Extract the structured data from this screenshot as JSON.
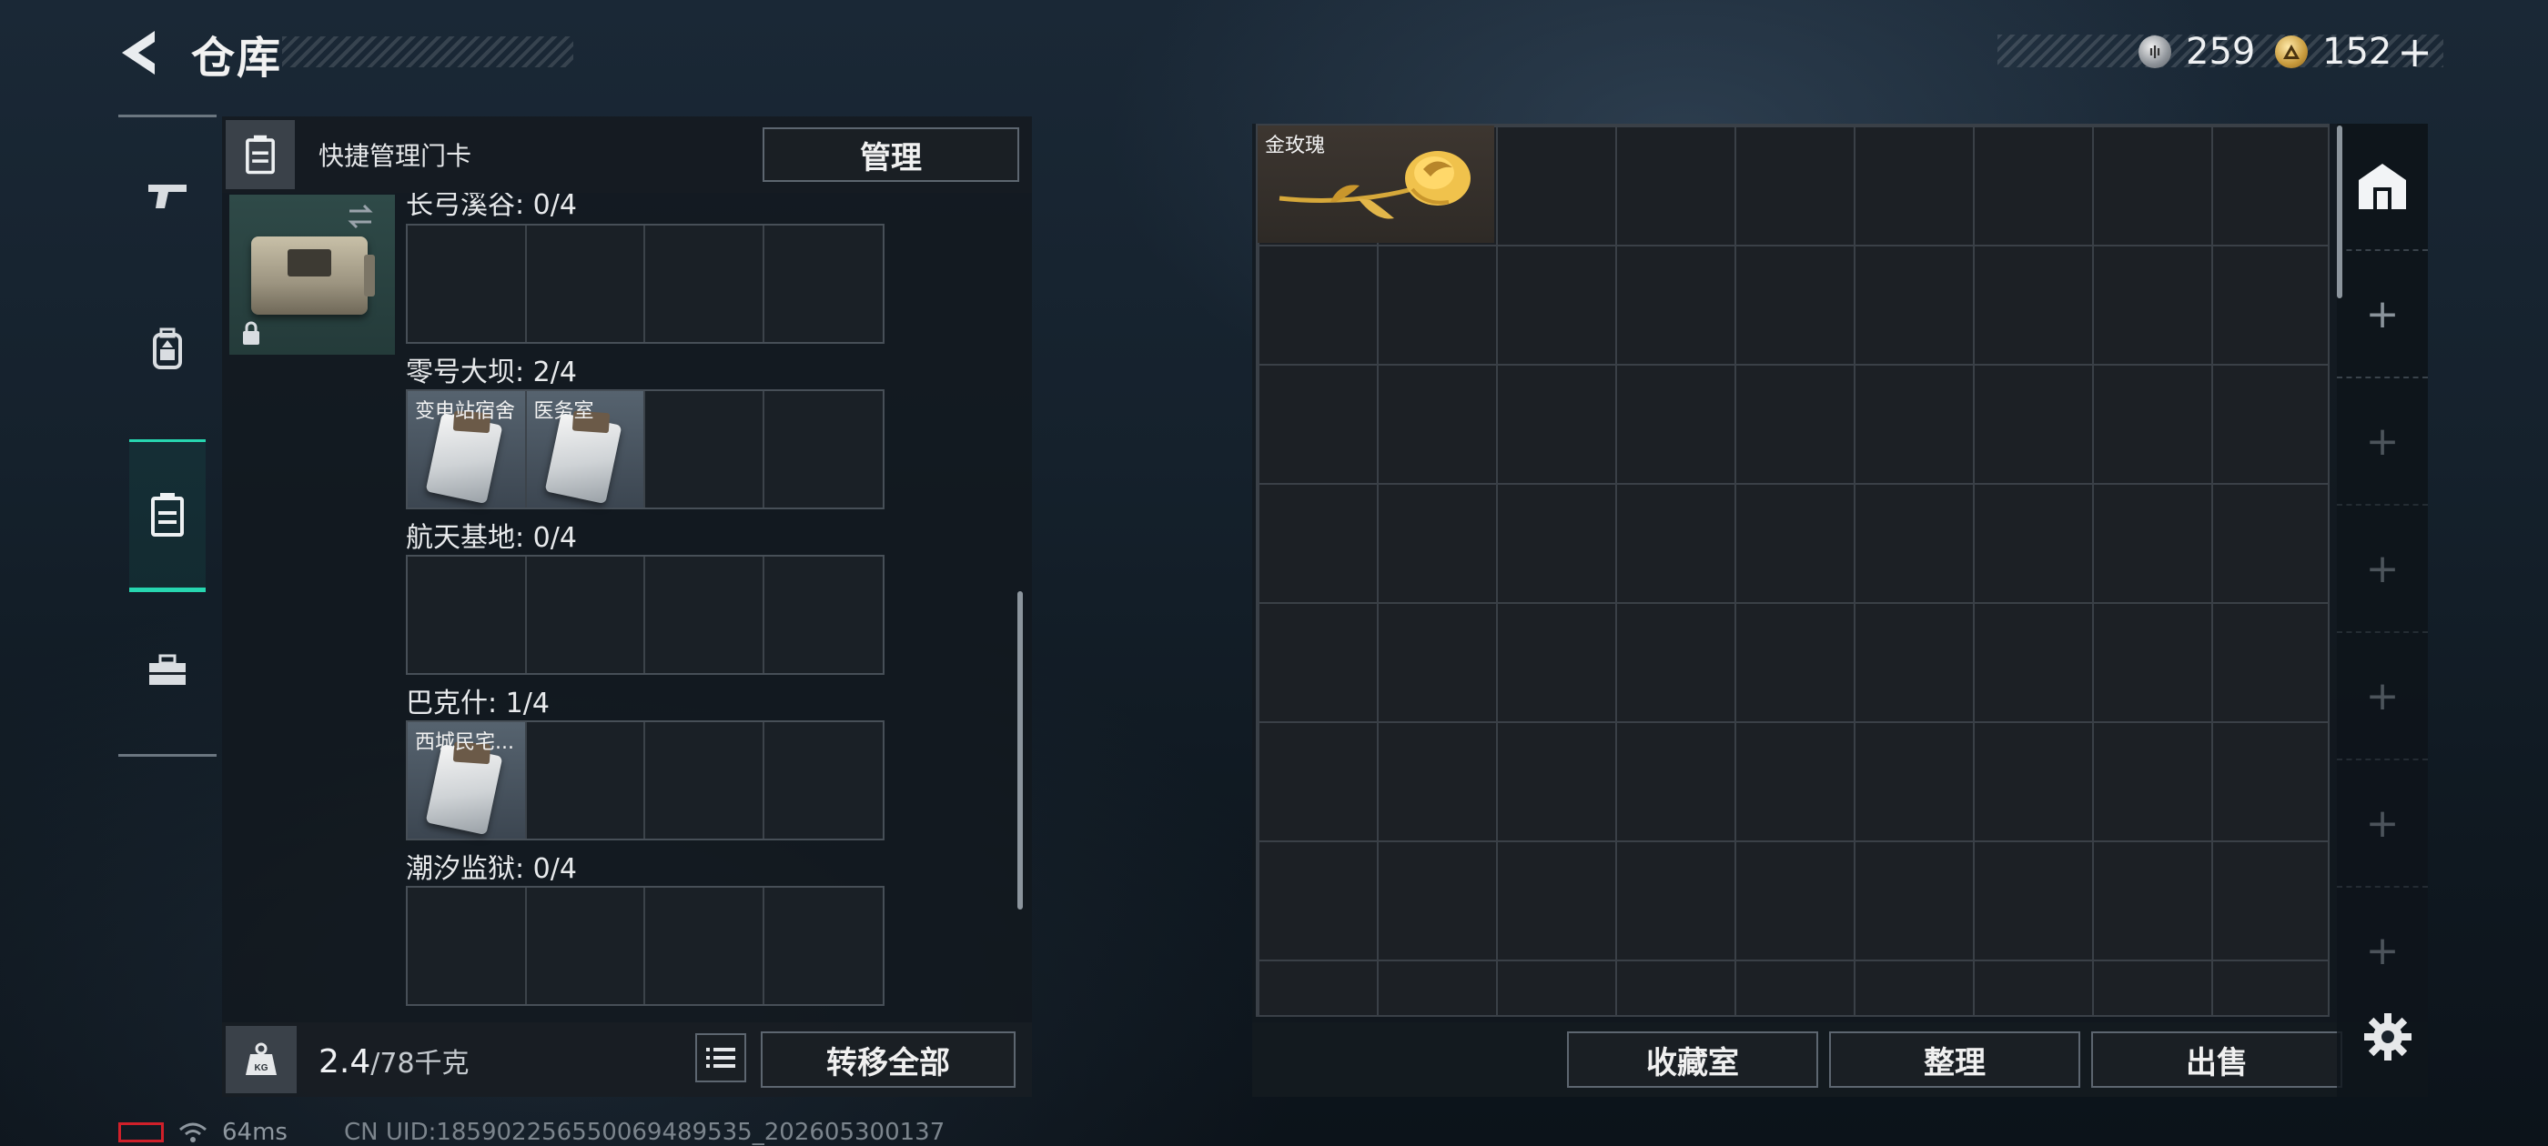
{
  "header": {
    "title": "仓库",
    "currencies": [
      {
        "icon": "silver-coin-icon",
        "value": "259"
      },
      {
        "icon": "gold-coin-icon",
        "value": "152"
      }
    ],
    "add_symbol": "+"
  },
  "side_nav": [
    {
      "icon": "pistol-icon",
      "active": false
    },
    {
      "icon": "backpack-icon",
      "active": false
    },
    {
      "icon": "keycard-case-icon",
      "active": true
    },
    {
      "icon": "toolbox-icon",
      "active": false
    }
  ],
  "keycard_panel": {
    "header_label": "快捷管理门卡",
    "manage_button": "管理",
    "maps": [
      {
        "label": "长弓溪谷: 0/4",
        "cards": []
      },
      {
        "label": "零号大坝: 2/4",
        "cards": [
          "变电站宿舍",
          "医务室"
        ]
      },
      {
        "label": "航天基地: 0/4",
        "cards": []
      },
      {
        "label": "巴克什: 1/4",
        "cards": [
          "西城民宅..."
        ]
      },
      {
        "label": "潮汐监狱: 0/4",
        "cards": []
      }
    ],
    "weight_value": "2.4",
    "weight_max": "/78千克",
    "weight_icon_text": "KG",
    "transfer_all_button": "转移全部"
  },
  "stash": {
    "items": [
      {
        "name": "金玫瑰"
      }
    ],
    "buttons": {
      "collection": "收藏室",
      "sort": "整理",
      "sell": "出售"
    },
    "side_add_symbol": "+"
  },
  "status_bar": {
    "ping": "64ms",
    "uid": "CN UID:185902256550069489535_202605300137"
  },
  "colors": {
    "accent": "#27d6b0",
    "alert": "#d0202a"
  }
}
